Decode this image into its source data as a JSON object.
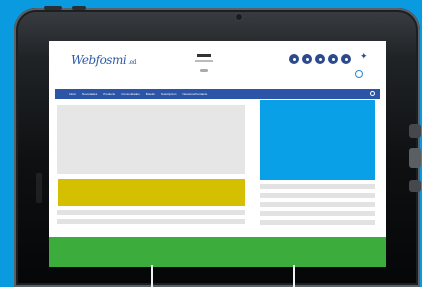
{
  "page": {
    "background_color": "#0a9ae0"
  },
  "device": {
    "type": "tablet",
    "frame_color": "#1a1d20"
  },
  "site": {
    "logo_text": "Webfosmi",
    "logo_tld": ".ed",
    "brand_color": "#2c55a8",
    "social_icons": [
      "social-icon",
      "social-icon",
      "social-icon",
      "social-icon",
      "social-icon"
    ],
    "nav_items": [
      "Inicio",
      "Novedades",
      "Producto",
      "Comunidades",
      "Boletin",
      "Suscripcion",
      "Nosotros/Contacto"
    ],
    "nav_color": "#2c55a8",
    "banner_color": "#d4c000",
    "side_image_color": "#0aa0e8",
    "footer_color": "#3cac3c",
    "placeholder_color": "#e6e6e6"
  }
}
